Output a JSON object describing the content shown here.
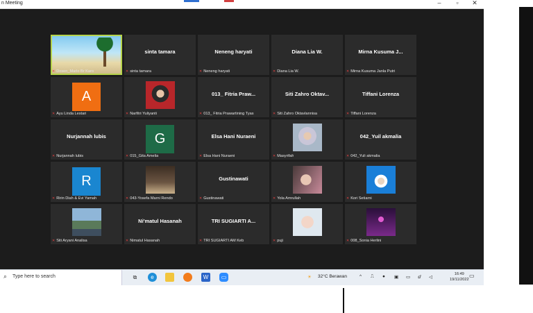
{
  "window": {
    "title": "n Meeting",
    "controls": [
      "–",
      "▫",
      "✕"
    ]
  },
  "participants": [
    {
      "big": "",
      "name": "Dosen_Marlo Br Karo",
      "kind": "beach",
      "active": true
    },
    {
      "big": "sinta tamara",
      "name": "sinta tamara"
    },
    {
      "big": "Neneng haryati",
      "name": "Neneng haryati"
    },
    {
      "big": "Diana Lia W.",
      "name": "Diana Lia W."
    },
    {
      "big": "Mirna Kusuma J...",
      "name": "Mirna Kusuma Janla Putri"
    },
    {
      "big": "",
      "name": "Ayu Linda Lestari",
      "kind": "letter",
      "letter": "A",
      "color": "#f06e12"
    },
    {
      "big": "",
      "name": "Narfitri Yuliyanti",
      "kind": "hijab-red"
    },
    {
      "big": "013_ Fitria Praw...",
      "name": "013_ Fitria Prawartining Tyas"
    },
    {
      "big": "Siti Zahro Oktav...",
      "name": "Siti Zahro Oktavlannisa"
    },
    {
      "big": "Tiffani Lorenza",
      "name": "Tiffani Lorenza"
    },
    {
      "big": "Nurjannah lubis",
      "name": "Nurjannah lubis"
    },
    {
      "big": "",
      "name": "015_Gita Amelia",
      "kind": "letter",
      "letter": "G",
      "color": "#1e6b47"
    },
    {
      "big": "Elsa Hani Nuraeni",
      "name": "Elsa Hani Nuraeni"
    },
    {
      "big": "",
      "name": "Masyrifah",
      "kind": "hijab-light"
    },
    {
      "big": "042_Yuil akmalia",
      "name": "042_Yuli akmalia"
    },
    {
      "big": "",
      "name": "Ririn Diah & Evi Yamah",
      "kind": "letter",
      "letter": "R",
      "color": "#1a86d0"
    },
    {
      "big": "",
      "name": "043-Yosefa Marni Rendo",
      "kind": "room"
    },
    {
      "big": "Gustinawati",
      "name": "Gustinawati"
    },
    {
      "big": "",
      "name": "Yola Amrullah",
      "kind": "selfie"
    },
    {
      "big": "",
      "name": "Kori Setiarni",
      "kind": "bluebg"
    },
    {
      "big": "",
      "name": "Siti Aryani Analisa",
      "kind": "city"
    },
    {
      "big": "Ni'matul Hasanah",
      "name": "Nimatul Hasanah"
    },
    {
      "big": "TRI SUGIARTI A...",
      "name": "TRI SUGIARTI AM Keb"
    },
    {
      "big": "",
      "name": "puji",
      "kind": "child"
    },
    {
      "big": "",
      "name": "008_Sonia Herlini",
      "kind": "stage"
    }
  ],
  "taskbar": {
    "search_placeholder": "Type here to search",
    "weather": "32°C  Berawan",
    "time": "16:49",
    "date": "19/11/2022"
  }
}
